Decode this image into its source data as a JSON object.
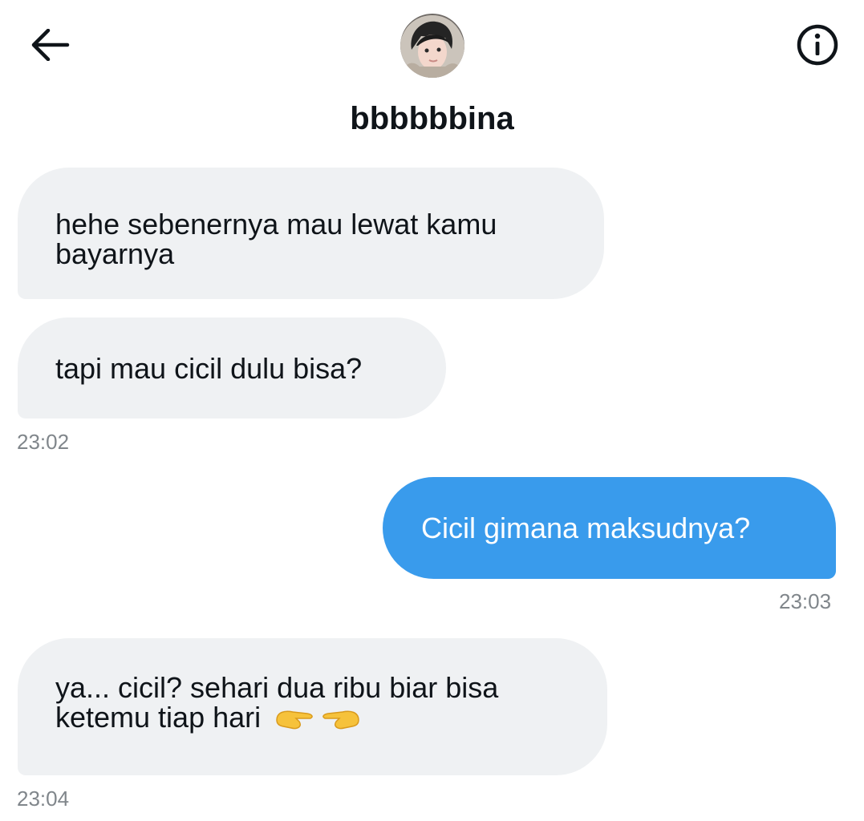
{
  "header": {
    "username": "bbbbbbina",
    "back_icon": "arrow-left-icon",
    "info_icon": "info-circle-icon"
  },
  "messages": [
    {
      "direction": "in",
      "text": "hehe sebenernya mau lewat kamu bayarnya"
    },
    {
      "direction": "in",
      "text": "tapi mau cicil dulu bisa?",
      "time": "23:02"
    },
    {
      "direction": "out",
      "text": "Cicil gimana maksudnya?",
      "time": "23:03"
    },
    {
      "direction": "in",
      "text": "ya... cicil? sehari dua ribu biar bisa ketemu tiap hari",
      "emoji": "pointing-fingers-emoji",
      "time": "23:04"
    }
  ],
  "colors": {
    "incoming_bubble": "#eff1f3",
    "outgoing_bubble": "#399bec",
    "timestamp": "#80868b"
  }
}
